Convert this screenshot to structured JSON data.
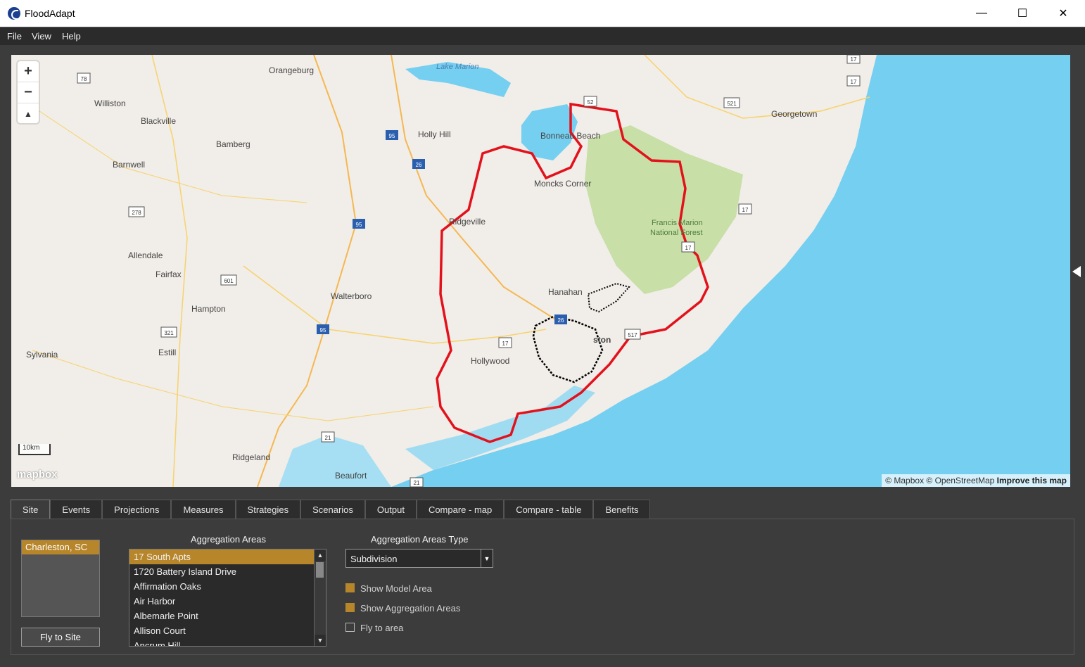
{
  "window": {
    "title": "FloodAdapt",
    "controls": [
      "—",
      "☐",
      "✕"
    ]
  },
  "menu": [
    "File",
    "View",
    "Help"
  ],
  "map": {
    "zoom_in": "+",
    "zoom_out": "−",
    "compass": "▲",
    "scale": "10km",
    "logo": "mapbox",
    "attribution": "© Mapbox © OpenStreetMap",
    "attribution_link": "Improve this map",
    "places": [
      "Orangeburg",
      "Williston",
      "Blackville",
      "Bamberg",
      "Barnwell",
      "Holly Hill",
      "Bonneau Beach",
      "Moncks Corner",
      "Georgetown",
      "Ridgeville",
      "Allendale",
      "Fairfax",
      "Walterboro",
      "Hampton",
      "Hanahan",
      "Estill",
      "Sylvania",
      "Hollywood",
      "Ridgeland",
      "Beaufort",
      "ston"
    ],
    "water_labels": [
      "Lake Marion"
    ],
    "forest_labels": [
      "Francis Marion",
      "National Forest"
    ],
    "route_shields": [
      "78",
      "278",
      "601",
      "321",
      "95",
      "95",
      "95",
      "26",
      "26",
      "52",
      "17",
      "17",
      "17",
      "17",
      "521",
      "17",
      "517",
      "21",
      "21"
    ]
  },
  "tabs": [
    "Site",
    "Events",
    "Projections",
    "Measures",
    "Strategies",
    "Scenarios",
    "Output",
    "Compare - map",
    "Compare - table",
    "Benefits"
  ],
  "site": {
    "sites": [
      "Charleston, SC"
    ],
    "fly_button": "Fly to Site",
    "agg_title": "Aggregation Areas",
    "agg_items": [
      "17 South Apts",
      "1720 Battery Island Drive",
      "Affirmation Oaks",
      "Air Harbor",
      "Albemarle Point",
      "Allison Court",
      "Ancrum Hill"
    ],
    "agg_type_title": "Aggregation Areas Type",
    "agg_type_value": "Subdivision",
    "checkboxes": [
      {
        "label": "Show Model Area",
        "checked": true
      },
      {
        "label": "Show Aggregation Areas",
        "checked": true
      },
      {
        "label": "Fly to area",
        "checked": false
      }
    ]
  },
  "colors": {
    "accent": "#b8862a",
    "boundary": "#e3111b",
    "water": "#75cff0",
    "land": "#f1ede8",
    "forest": "#c8dfa8"
  }
}
